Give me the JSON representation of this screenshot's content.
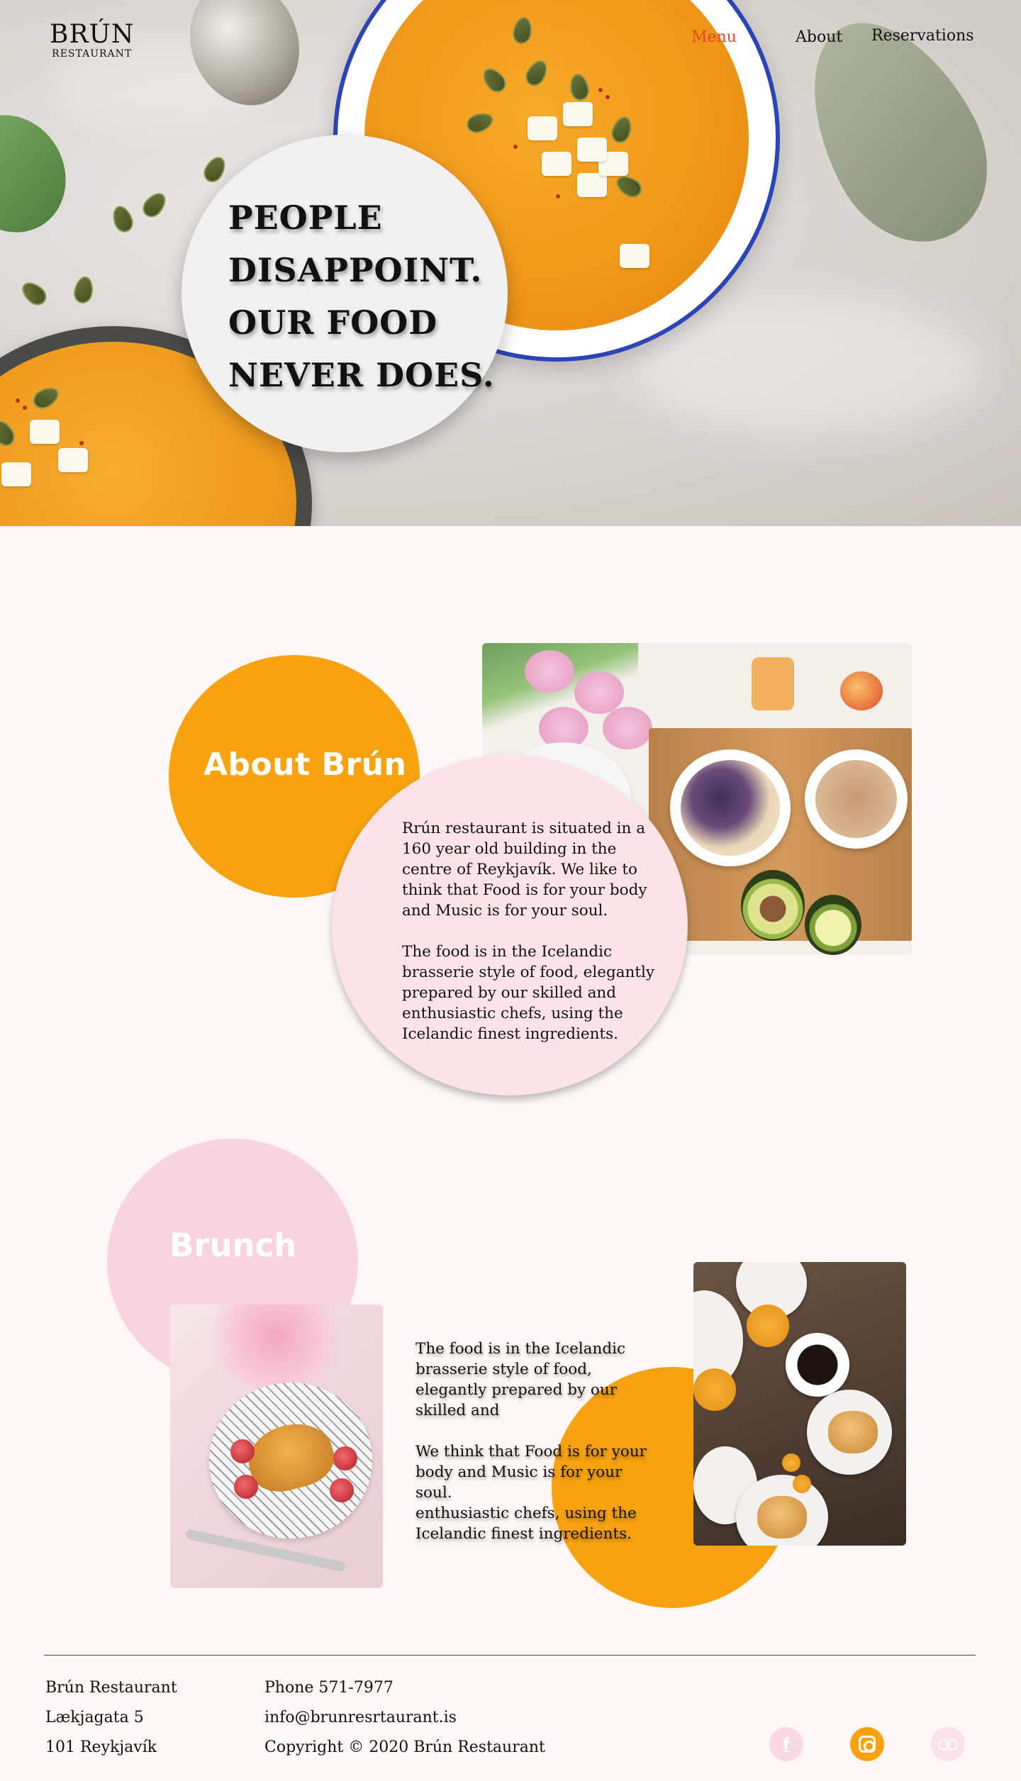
{
  "brand": {
    "name": "BRÚN",
    "sub": "RESTAURANT"
  },
  "nav": {
    "menu": "Menu",
    "about": "About",
    "reservations": "Reservations"
  },
  "hero": {
    "tagline": "PEOPLE\nDISAPPOINT.\nOUR FOOD\nNEVER DOES."
  },
  "about": {
    "heading": "About Brún",
    "text": "Rrún restaurant is situated in a 160 year old building in the centre of Reykjavík. We like to think that Food is for your body and Music is for your soul.\n\nThe food is in the Icelandic brasserie style of food, elegantly prepared by our skilled and enthusiastic chefs, using the Icelandic finest ingredients."
  },
  "brunch": {
    "heading": "Brunch",
    "text": "The food is in the Icelandic brasserie style of food, elegantly prepared by our skilled and\n\nWe think that Food is for your body and Music is for your soul.\nenthusiastic chefs, using the Icelandic finest ingredients."
  },
  "footer": {
    "name": "Brún Restaurant",
    "street": "Lækjagata 5",
    "city": "101 Reykjavík",
    "phone": "Phone 571-7977",
    "email": "info@brunresrtaurant.is",
    "copyright": "Copyright © 2020 Brún Restaurant"
  },
  "social": {
    "facebook_glyph": "f",
    "icons": [
      "facebook-icon",
      "instagram-icon",
      "tripadvisor-icon"
    ]
  },
  "colors": {
    "accent_orange": "#f7a20e",
    "accent_pink": "#fbe3e8",
    "nav_active": "#e3472b",
    "background": "#fdf8f5"
  }
}
